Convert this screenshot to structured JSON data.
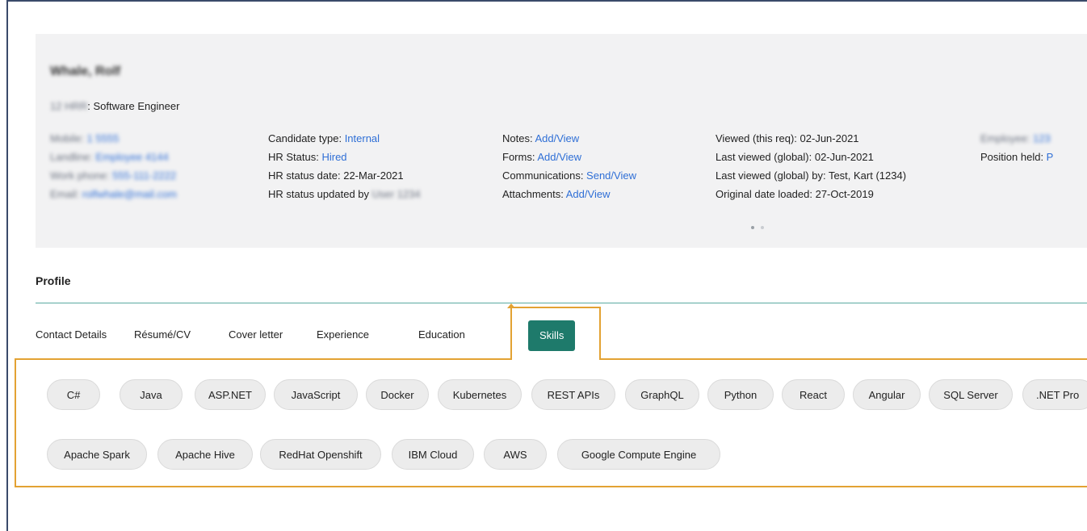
{
  "candidate": {
    "name": "Whale, Rolf",
    "req_prefix": "12 HRR",
    "req_title": ": Software Engineer"
  },
  "contact": [
    {
      "label": "Mobile:",
      "value": "1 5555"
    },
    {
      "label": "Landline:",
      "value": "Employee 4144"
    },
    {
      "label": "Work phone:",
      "value": "555-111-2222"
    },
    {
      "label": "Email:",
      "value": "rolfwhale@mail.com"
    }
  ],
  "status": [
    {
      "label": "Candidate type: ",
      "value": "Internal",
      "is_link": true
    },
    {
      "label": "HR Status: ",
      "value": "Hired",
      "is_link": true
    },
    {
      "label": "HR status date: 22-Mar-2021",
      "value": "",
      "is_link": false
    },
    {
      "label": "HR status updated by ",
      "value": "User 1234",
      "is_link": false,
      "blurred": true
    }
  ],
  "links": [
    {
      "label": "Notes: ",
      "value": "Add/View"
    },
    {
      "label": "Forms: ",
      "value": "Add/View"
    },
    {
      "label": "Communications: ",
      "value": "Send/View"
    },
    {
      "label": "Attachments: ",
      "value": "Add/View"
    }
  ],
  "viewed": [
    "Viewed (this req): 02-Jun-2021",
    "Last viewed (global): 02-Jun-2021",
    "Last viewed (global) by: Test, Kart (1234)",
    "Original date loaded: 27-Oct-2019"
  ],
  "extra": [
    {
      "label": "Employee: ",
      "value": "123"
    },
    {
      "label": "Position held: ",
      "value": "P"
    }
  ],
  "profile": {
    "title": "Profile",
    "tabs": [
      "Contact Details",
      "Résumé/CV",
      "Cover letter",
      "Experience",
      "Education",
      "Skills"
    ],
    "active_tab": "Skills"
  },
  "skills_row1": [
    "C#",
    "Java",
    "ASP.NET",
    "JavaScript",
    "Docker",
    "Kubernetes",
    "REST APIs",
    "GraphQL",
    "Python",
    "React",
    "Angular",
    "SQL Server",
    ".NET Pro"
  ],
  "skills_row2": [
    "Apache Spark",
    "Apache Hive",
    "RedHat Openshift",
    "IBM Cloud",
    "AWS",
    "Google Compute Engine"
  ],
  "colors": {
    "accent": "#1e7a6b",
    "link": "#2f6fd6",
    "highlight": "#e3a233",
    "card_bg": "#f2f2f3"
  }
}
